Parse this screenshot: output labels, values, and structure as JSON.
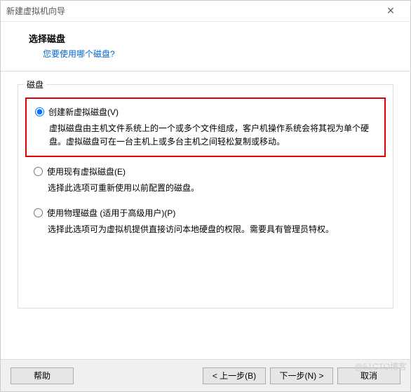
{
  "window": {
    "title": "新建虚拟机向导",
    "close_glyph": "✕"
  },
  "header": {
    "heading": "选择磁盘",
    "subheading": "您要使用哪个磁盘?"
  },
  "group": {
    "title": "磁盘"
  },
  "options": {
    "create": {
      "label": "创建新虚拟磁盘(V)",
      "desc": "虚拟磁盘由主机文件系统上的一个或多个文件组成，客户机操作系统会将其视为单个硬盘。虚拟磁盘可在一台主机上或多台主机之间轻松复制或移动。",
      "checked": true
    },
    "existing": {
      "label": "使用现有虚拟磁盘(E)",
      "desc": "选择此选项可重新使用以前配置的磁盘。",
      "checked": false
    },
    "physical": {
      "label": "使用物理磁盘 (适用于高级用户)(P)",
      "desc": "选择此选项可为虚拟机提供直接访问本地硬盘的权限。需要具有管理员特权。",
      "checked": false
    }
  },
  "footer": {
    "help": "帮助",
    "back": "< 上一步(B)",
    "next": "下一步(N) >",
    "cancel": "取消"
  },
  "watermark": "@51CTO博客"
}
